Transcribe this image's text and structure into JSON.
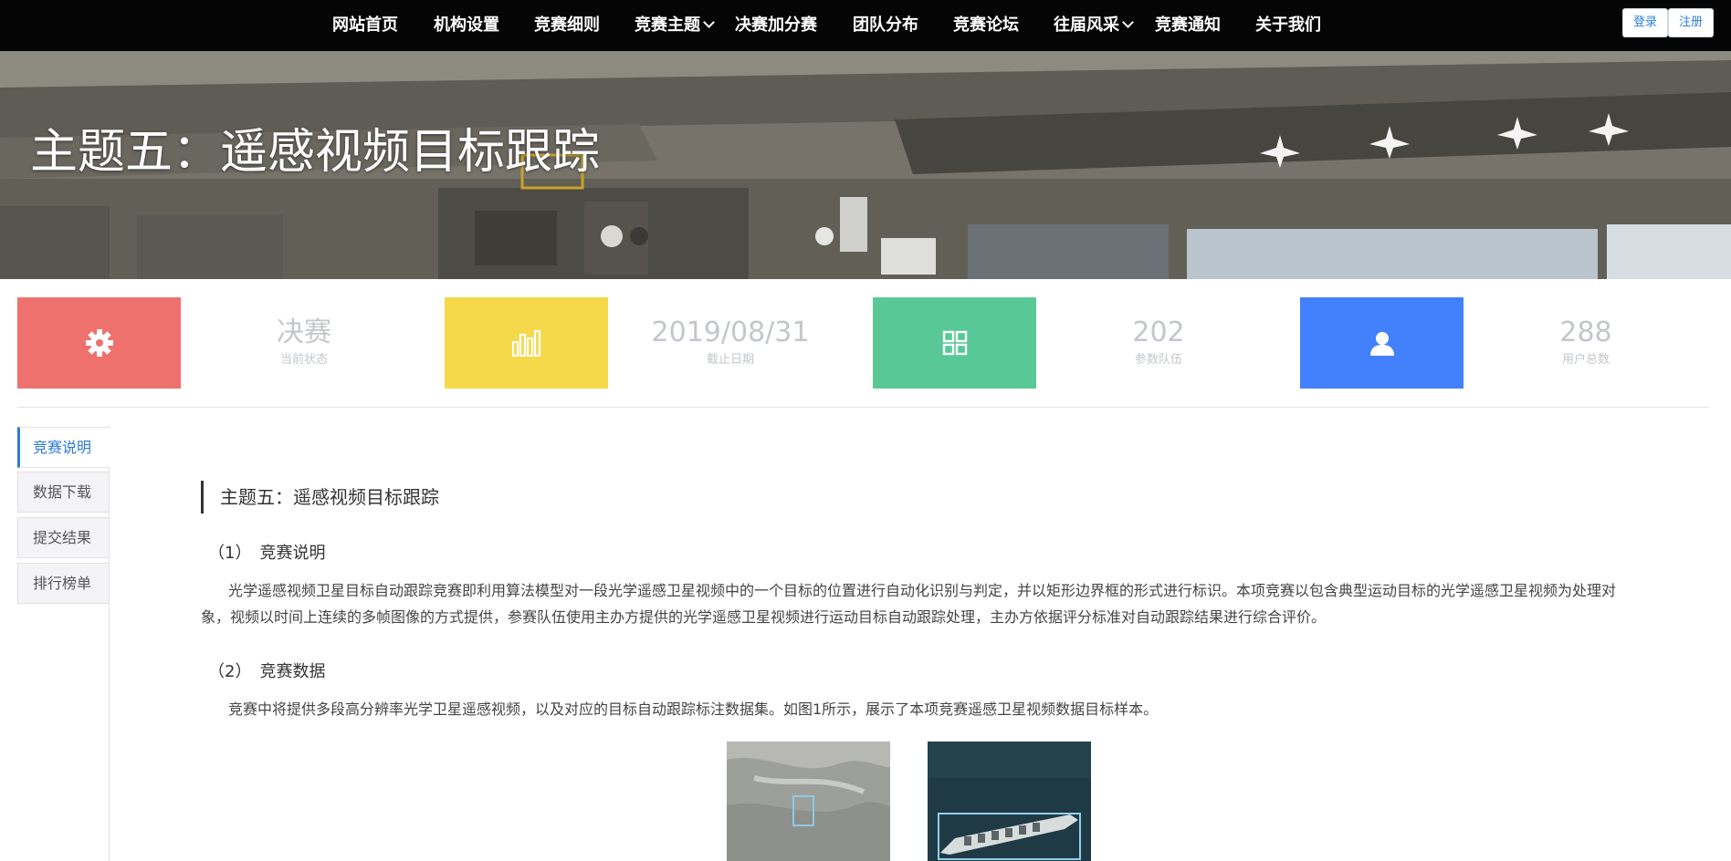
{
  "nav": {
    "items": [
      "网站首页",
      "机构设置",
      "竞赛细则",
      "竞赛主题",
      "决赛加分赛",
      "团队分布",
      "竞赛论坛",
      "往届风采",
      "竞赛通知",
      "关于我们"
    ],
    "login": "登录",
    "register": "注册"
  },
  "hero": {
    "title": "主题五：遥感视频目标跟踪"
  },
  "stats": [
    {
      "value": "决赛",
      "label": "当前状态",
      "color": "#ee716e",
      "icon": "gear-icon"
    },
    {
      "value": "2019/08/31",
      "label": "截止日期",
      "color": "#f5d94b",
      "icon": "bar-chart-icon"
    },
    {
      "value": "202",
      "label": "参数队伍",
      "color": "#58c996",
      "icon": "grid-icon"
    },
    {
      "value": "288",
      "label": "用户总数",
      "color": "#4280fc",
      "icon": "user-icon"
    }
  ],
  "side_tabs": [
    "竞赛说明",
    "数据下载",
    "提交结果",
    "排行榜单"
  ],
  "content": {
    "title": "主题五：遥感视频目标跟踪",
    "s1_head": "（1）　竞赛说明",
    "s1_text": "光学遥感视频卫星目标自动跟踪竞赛即利用算法模型对一段光学遥感卫星视频中的一个目标的位置进行自动化识别与判定，并以矩形边界框的形式进行标识。本项竞赛以包含典型运动目标的光学遥感卫星视频为处理对象，视频以时间上连续的多帧图像的方式提供，参赛队伍使用主办方提供的光学遥感卫星视频进行运动目标自动跟踪处理，主办方依据评分标准对自动跟踪结果进行综合评价。",
    "s2_head": "（2）　竞赛数据",
    "s2_text": "竞赛中将提供多段高分辨率光学卫星遥感视频，以及对应的目标自动跟踪标注数据集。如图1所示，展示了本项竞赛遥感卫星视频数据目标样本。"
  }
}
